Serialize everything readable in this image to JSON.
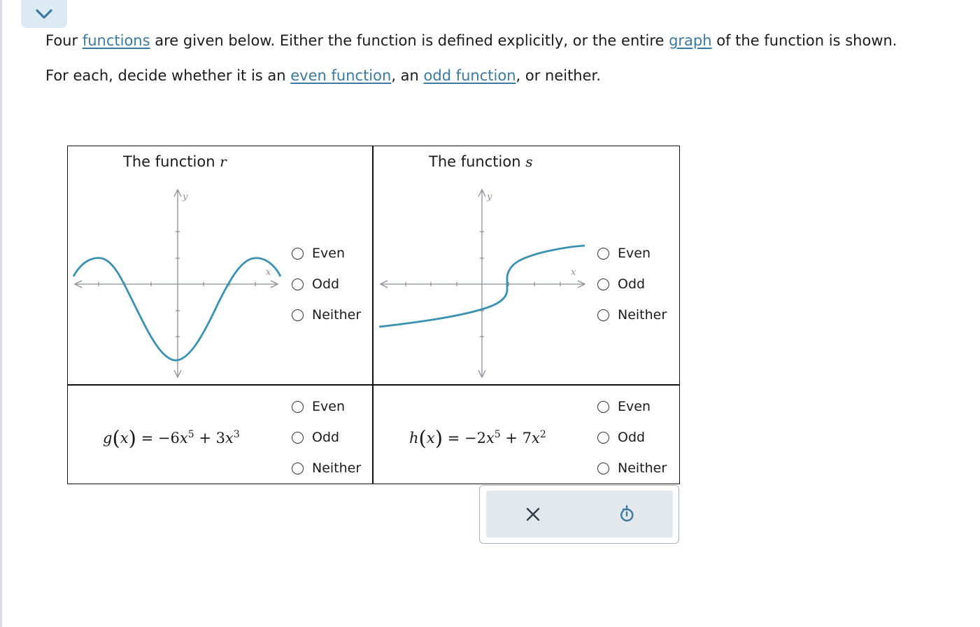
{
  "intro": {
    "line1": {
      "t1": "Four ",
      "link_functions": "functions",
      "t2": " are given below. Either the function is defined explicitly, or the entire ",
      "link_graph": "graph",
      "t3": " of the function is shown."
    },
    "line2": {
      "t1": "For each, decide whether it is an ",
      "link_even": "even function",
      "t2": ", an ",
      "link_odd": "odd function",
      "t3": ", or neither."
    }
  },
  "panels": {
    "r": {
      "title": "The function ",
      "var": "r",
      "axis_x": "x",
      "axis_y": "y",
      "options": [
        "Even",
        "Odd",
        "Neither"
      ]
    },
    "s": {
      "title": "The function ",
      "var": "s",
      "axis_x": "x",
      "axis_y": "y",
      "options": [
        "Even",
        "Odd",
        "Neither"
      ]
    },
    "g": {
      "name": "g",
      "arg": "x",
      "eq": " = ",
      "coef1": "−6",
      "exp1": "5",
      "op": " + ",
      "coef2": "3",
      "exp2": "3",
      "options": [
        "Even",
        "Odd",
        "Neither"
      ]
    },
    "h": {
      "name": "h",
      "arg": "x",
      "eq": " = ",
      "coef1": "−2",
      "exp1": "5",
      "op": " + ",
      "coef2": "7",
      "exp2": "2",
      "options": [
        "Even",
        "Odd",
        "Neither"
      ]
    }
  },
  "colors": {
    "accent": "#3a7aa3",
    "curve": "#3a91b0",
    "axis": "#8a9099"
  },
  "icons": {
    "collapse": "chevron-down-icon",
    "clear": "close-icon",
    "reset": "undo-icon"
  }
}
